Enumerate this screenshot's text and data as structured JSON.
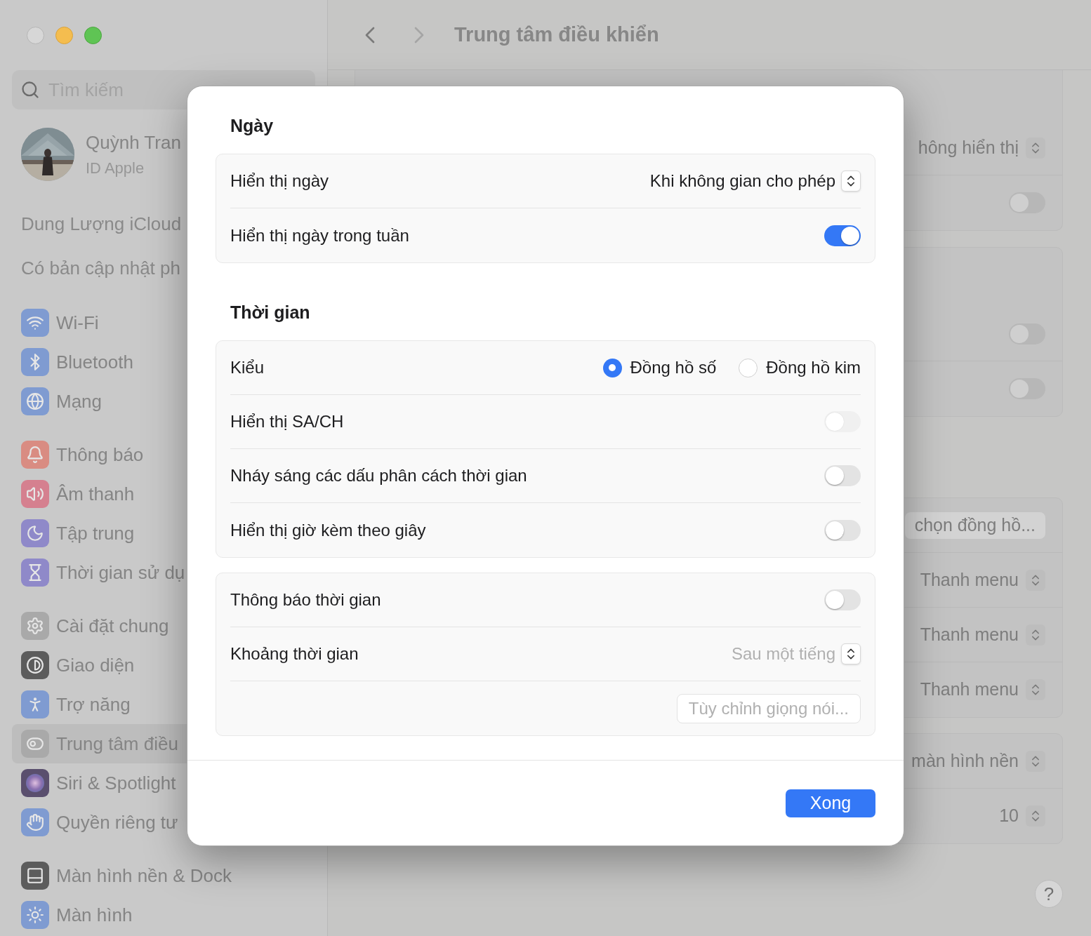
{
  "window": {
    "title": "Trung tâm điều khiển"
  },
  "sidebar": {
    "search": {
      "placeholder": "Tìm kiếm"
    },
    "account": {
      "name": "Quỳnh Tran",
      "subtitle": "ID Apple"
    },
    "notices": [
      "Dung Lượng iCloud",
      "Có bản cập nhật ph"
    ],
    "groups": [
      [
        {
          "label": "Wi-Fi",
          "kind": "wifi",
          "selected": false
        },
        {
          "label": "Bluetooth",
          "kind": "bluetooth",
          "selected": false
        },
        {
          "label": "Mạng",
          "kind": "globe",
          "selected": false
        }
      ],
      [
        {
          "label": "Thông báo",
          "kind": "bell",
          "selected": false
        },
        {
          "label": "Âm thanh",
          "kind": "sound",
          "selected": false
        },
        {
          "label": "Tập trung",
          "kind": "moon",
          "selected": false
        },
        {
          "label": "Thời gian sử dụ",
          "kind": "hourglass",
          "selected": false
        }
      ],
      [
        {
          "label": "Cài đặt chung",
          "kind": "gear",
          "selected": false
        },
        {
          "label": "Giao diện",
          "kind": "appearance",
          "selected": false
        },
        {
          "label": "Trợ năng",
          "kind": "accessibility",
          "selected": false
        },
        {
          "label": "Trung tâm điều",
          "kind": "controls",
          "selected": true
        },
        {
          "label": "Siri & Spotlight",
          "kind": "siri",
          "selected": false
        },
        {
          "label": "Quyền riêng tư",
          "kind": "hand",
          "selected": false
        }
      ],
      [
        {
          "label": "Màn hình nền & Dock",
          "kind": "dock",
          "selected": false
        },
        {
          "label": "Màn hình",
          "kind": "sun",
          "selected": false
        }
      ]
    ]
  },
  "content": {
    "cards": [
      {
        "rows": [
          {
            "kind": "select",
            "value": "hông hiển thị"
          },
          {
            "kind": "toggle",
            "on": false
          }
        ]
      },
      {
        "rows": [
          {
            "kind": "toggle",
            "on": false
          },
          {
            "kind": "toggle",
            "on": false
          }
        ]
      },
      {
        "rows": [
          {
            "kind": "button",
            "label": "chọn đồng hồ..."
          },
          {
            "kind": "select",
            "value": "Thanh menu"
          },
          {
            "kind": "select",
            "value": "Thanh menu"
          },
          {
            "kind": "select",
            "value": "Thanh menu"
          }
        ]
      },
      {
        "rows": [
          {
            "kind": "select",
            "value": "màn hình nền"
          },
          {
            "kind": "select",
            "value": "10"
          }
        ]
      }
    ]
  },
  "help_button": "?",
  "dialog": {
    "sections": [
      {
        "title": "Ngày",
        "cards": [
          {
            "rows": [
              {
                "kind": "select",
                "label": "Hiển thị ngày",
                "value": "Khi không gian cho phép",
                "disabled": false
              },
              {
                "kind": "toggle",
                "label": "Hiển thị ngày trong tuần",
                "on": true,
                "disabled": false
              }
            ]
          }
        ]
      },
      {
        "title": "Thời gian",
        "cards": [
          {
            "rows": [
              {
                "kind": "radio",
                "label": "Kiểu",
                "options": [
                  {
                    "label": "Đồng hồ số",
                    "selected": true
                  },
                  {
                    "label": "Đồng hồ kim",
                    "selected": false
                  }
                ]
              },
              {
                "kind": "toggle",
                "label": "Hiển thị SA/CH",
                "on": false,
                "disabled": true
              },
              {
                "kind": "toggle",
                "label": "Nháy sáng các dấu phân cách thời gian",
                "on": false,
                "disabled": false
              },
              {
                "kind": "toggle",
                "label": "Hiển thị giờ kèm theo giây",
                "on": false,
                "disabled": false
              }
            ]
          },
          {
            "rows": [
              {
                "kind": "toggle",
                "label": "Thông báo thời gian",
                "on": false,
                "disabled": false
              },
              {
                "kind": "select",
                "label": "Khoảng thời gian",
                "value": "Sau một tiếng",
                "disabled": true
              },
              {
                "kind": "button",
                "label": "Tùy chỉnh giọng nói...",
                "disabled": true
              }
            ]
          }
        ]
      }
    ],
    "done_button": "Xong"
  }
}
